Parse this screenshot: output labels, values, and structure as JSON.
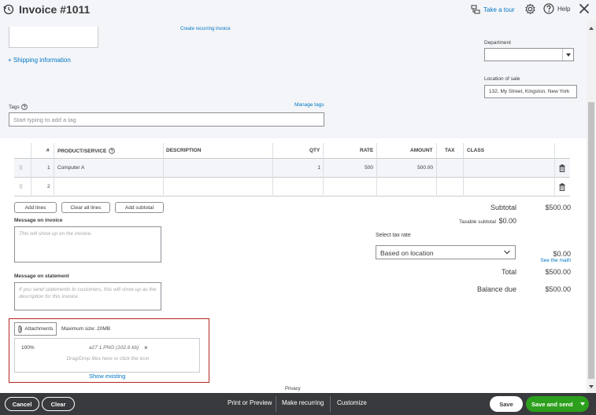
{
  "header": {
    "title": "Invoice #1011",
    "tour_label": "Take a tour",
    "help_label": "Help"
  },
  "top": {
    "create_recurring": "Create recurring invoice",
    "shipping_info": "+ Shipping information",
    "department_label": "Department",
    "department_value": "",
    "location_label": "Location of sale",
    "location_value": "132, My Street, Kingston, New York",
    "tag_label": "Tags",
    "manage_tags": "Manage tags",
    "tag_placeholder": "Start typing to add a tag"
  },
  "table": {
    "columns": [
      "#",
      "PRODUCT/SERVICE",
      "DESCRIPTION",
      "QTY",
      "RATE",
      "AMOUNT",
      "TAX",
      "CLASS"
    ],
    "rows": [
      {
        "num": "1",
        "product": "Computer A",
        "description": "",
        "qty": "1",
        "rate": "500",
        "amount": "500.00",
        "tax": "",
        "class": ""
      },
      {
        "num": "2",
        "product": "",
        "description": "",
        "qty": "",
        "rate": "",
        "amount": "",
        "tax": "",
        "class": ""
      }
    ]
  },
  "actions": {
    "add_lines": "Add lines",
    "clear_all_lines": "Clear all lines",
    "add_subtotal": "Add subtotal"
  },
  "messages": {
    "invoice_label": "Message on invoice",
    "invoice_placeholder": "This will show up on the invoice.",
    "statement_label": "Message on statement",
    "statement_placeholder": "If you send statements to customers, this will show up as the description for this invoice."
  },
  "totals": {
    "subtotal_label": "Subtotal",
    "subtotal_value": "$500.00",
    "taxable_subtotal_label": "Taxable subtotal",
    "taxable_subtotal_value": "$0.00",
    "select_tax_rate_label": "Select tax rate",
    "tax_rate_value": "Based on location",
    "tax_value": "$0.00",
    "see_the_math": "See the math",
    "total_label": "Total",
    "total_value": "$500.00",
    "balance_due_label": "Balance due",
    "balance_due_value": "$500.00"
  },
  "attachments": {
    "button_label": "Attachments",
    "max_size": "Maximum size: 20MB",
    "progress": "100%",
    "file_name": "a27 1.PNG (102.6 kb)",
    "remove": "×",
    "drop_hint": "Drag/Drop files here or click the icon",
    "show_existing": "Show existing"
  },
  "privacy": "Privacy",
  "footer": {
    "cancel": "Cancel",
    "clear": "Clear",
    "print_preview": "Print or Preview",
    "make_recurring": "Make recurring",
    "customize": "Customize",
    "save": "Save",
    "save_and_send": "Save and send"
  },
  "colors": {
    "accent_link": "#0077c5",
    "primary_green": "#2ca01c",
    "footer_dark": "#393a3d",
    "highlight_red": "#b5261e"
  }
}
